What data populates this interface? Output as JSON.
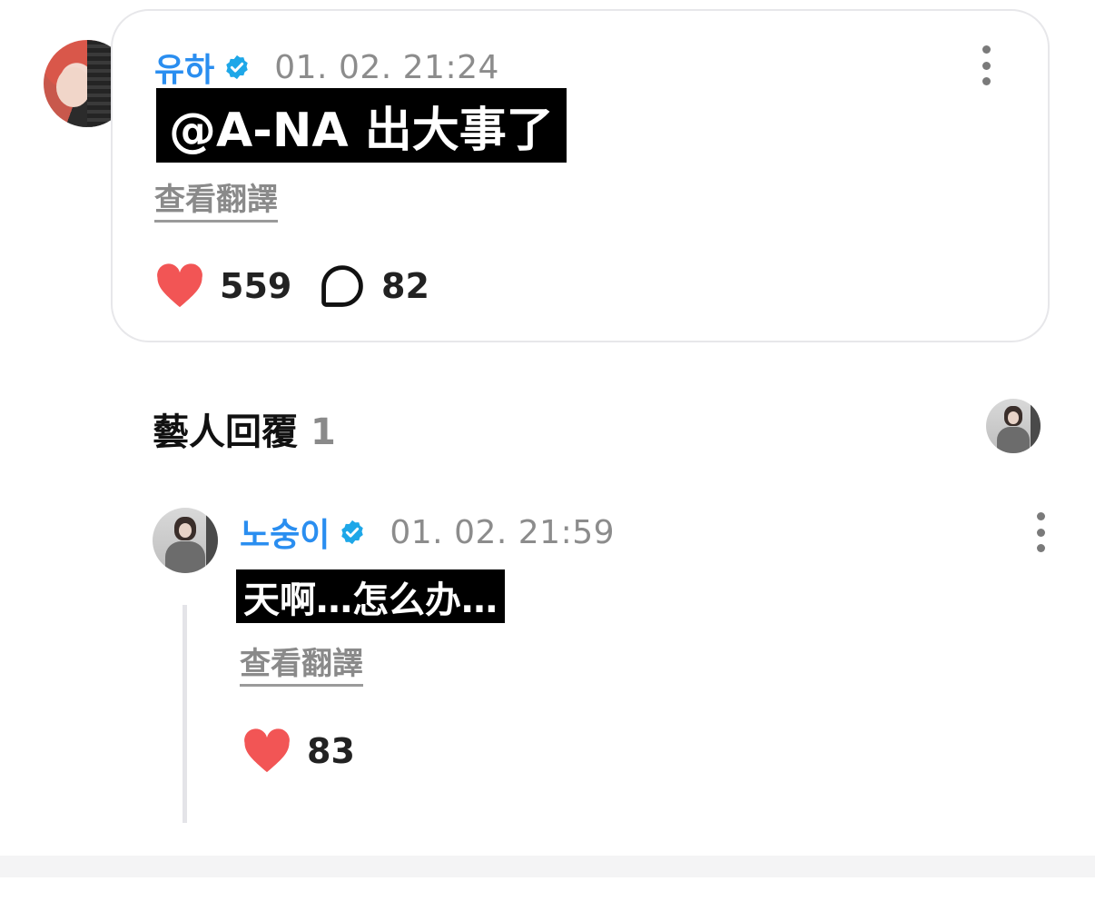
{
  "post": {
    "username": "유하",
    "timestamp": "01. 02. 21:24",
    "text": "@A-NA 出大事了",
    "translate_label": "查看翻譯",
    "likes": "559",
    "comments": "82"
  },
  "replies_section": {
    "title": "藝人回覆",
    "count": "1"
  },
  "reply": {
    "username": "노숭이",
    "timestamp": "01. 02. 21:59",
    "text": "天啊…怎么办…",
    "translate_label": "查看翻譯",
    "likes": "83"
  },
  "colors": {
    "username": "#2a8ef0",
    "verified_badge": "#1ea7e8",
    "like_heart": "#f25555"
  }
}
